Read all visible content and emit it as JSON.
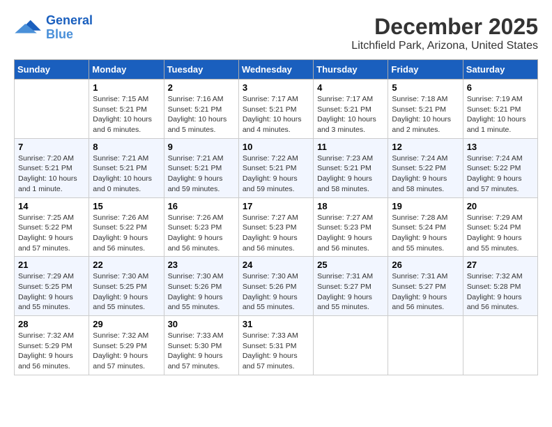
{
  "header": {
    "logo": "GeneralBlue",
    "title": "December 2025",
    "subtitle": "Litchfield Park, Arizona, United States"
  },
  "columns": [
    "Sunday",
    "Monday",
    "Tuesday",
    "Wednesday",
    "Thursday",
    "Friday",
    "Saturday"
  ],
  "weeks": [
    [
      {
        "day": "",
        "info": ""
      },
      {
        "day": "1",
        "info": "Sunrise: 7:15 AM\nSunset: 5:21 PM\nDaylight: 10 hours\nand 6 minutes."
      },
      {
        "day": "2",
        "info": "Sunrise: 7:16 AM\nSunset: 5:21 PM\nDaylight: 10 hours\nand 5 minutes."
      },
      {
        "day": "3",
        "info": "Sunrise: 7:17 AM\nSunset: 5:21 PM\nDaylight: 10 hours\nand 4 minutes."
      },
      {
        "day": "4",
        "info": "Sunrise: 7:17 AM\nSunset: 5:21 PM\nDaylight: 10 hours\nand 3 minutes."
      },
      {
        "day": "5",
        "info": "Sunrise: 7:18 AM\nSunset: 5:21 PM\nDaylight: 10 hours\nand 2 minutes."
      },
      {
        "day": "6",
        "info": "Sunrise: 7:19 AM\nSunset: 5:21 PM\nDaylight: 10 hours\nand 1 minute."
      }
    ],
    [
      {
        "day": "7",
        "info": "Sunrise: 7:20 AM\nSunset: 5:21 PM\nDaylight: 10 hours\nand 1 minute."
      },
      {
        "day": "8",
        "info": "Sunrise: 7:21 AM\nSunset: 5:21 PM\nDaylight: 10 hours\nand 0 minutes."
      },
      {
        "day": "9",
        "info": "Sunrise: 7:21 AM\nSunset: 5:21 PM\nDaylight: 9 hours\nand 59 minutes."
      },
      {
        "day": "10",
        "info": "Sunrise: 7:22 AM\nSunset: 5:21 PM\nDaylight: 9 hours\nand 59 minutes."
      },
      {
        "day": "11",
        "info": "Sunrise: 7:23 AM\nSunset: 5:21 PM\nDaylight: 9 hours\nand 58 minutes."
      },
      {
        "day": "12",
        "info": "Sunrise: 7:24 AM\nSunset: 5:22 PM\nDaylight: 9 hours\nand 58 minutes."
      },
      {
        "day": "13",
        "info": "Sunrise: 7:24 AM\nSunset: 5:22 PM\nDaylight: 9 hours\nand 57 minutes."
      }
    ],
    [
      {
        "day": "14",
        "info": "Sunrise: 7:25 AM\nSunset: 5:22 PM\nDaylight: 9 hours\nand 57 minutes."
      },
      {
        "day": "15",
        "info": "Sunrise: 7:26 AM\nSunset: 5:22 PM\nDaylight: 9 hours\nand 56 minutes."
      },
      {
        "day": "16",
        "info": "Sunrise: 7:26 AM\nSunset: 5:23 PM\nDaylight: 9 hours\nand 56 minutes."
      },
      {
        "day": "17",
        "info": "Sunrise: 7:27 AM\nSunset: 5:23 PM\nDaylight: 9 hours\nand 56 minutes."
      },
      {
        "day": "18",
        "info": "Sunrise: 7:27 AM\nSunset: 5:23 PM\nDaylight: 9 hours\nand 56 minutes."
      },
      {
        "day": "19",
        "info": "Sunrise: 7:28 AM\nSunset: 5:24 PM\nDaylight: 9 hours\nand 55 minutes."
      },
      {
        "day": "20",
        "info": "Sunrise: 7:29 AM\nSunset: 5:24 PM\nDaylight: 9 hours\nand 55 minutes."
      }
    ],
    [
      {
        "day": "21",
        "info": "Sunrise: 7:29 AM\nSunset: 5:25 PM\nDaylight: 9 hours\nand 55 minutes."
      },
      {
        "day": "22",
        "info": "Sunrise: 7:30 AM\nSunset: 5:25 PM\nDaylight: 9 hours\nand 55 minutes."
      },
      {
        "day": "23",
        "info": "Sunrise: 7:30 AM\nSunset: 5:26 PM\nDaylight: 9 hours\nand 55 minutes."
      },
      {
        "day": "24",
        "info": "Sunrise: 7:30 AM\nSunset: 5:26 PM\nDaylight: 9 hours\nand 55 minutes."
      },
      {
        "day": "25",
        "info": "Sunrise: 7:31 AM\nSunset: 5:27 PM\nDaylight: 9 hours\nand 55 minutes."
      },
      {
        "day": "26",
        "info": "Sunrise: 7:31 AM\nSunset: 5:27 PM\nDaylight: 9 hours\nand 56 minutes."
      },
      {
        "day": "27",
        "info": "Sunrise: 7:32 AM\nSunset: 5:28 PM\nDaylight: 9 hours\nand 56 minutes."
      }
    ],
    [
      {
        "day": "28",
        "info": "Sunrise: 7:32 AM\nSunset: 5:29 PM\nDaylight: 9 hours\nand 56 minutes."
      },
      {
        "day": "29",
        "info": "Sunrise: 7:32 AM\nSunset: 5:29 PM\nDaylight: 9 hours\nand 57 minutes."
      },
      {
        "day": "30",
        "info": "Sunrise: 7:33 AM\nSunset: 5:30 PM\nDaylight: 9 hours\nand 57 minutes."
      },
      {
        "day": "31",
        "info": "Sunrise: 7:33 AM\nSunset: 5:31 PM\nDaylight: 9 hours\nand 57 minutes."
      },
      {
        "day": "",
        "info": ""
      },
      {
        "day": "",
        "info": ""
      },
      {
        "day": "",
        "info": ""
      }
    ]
  ]
}
